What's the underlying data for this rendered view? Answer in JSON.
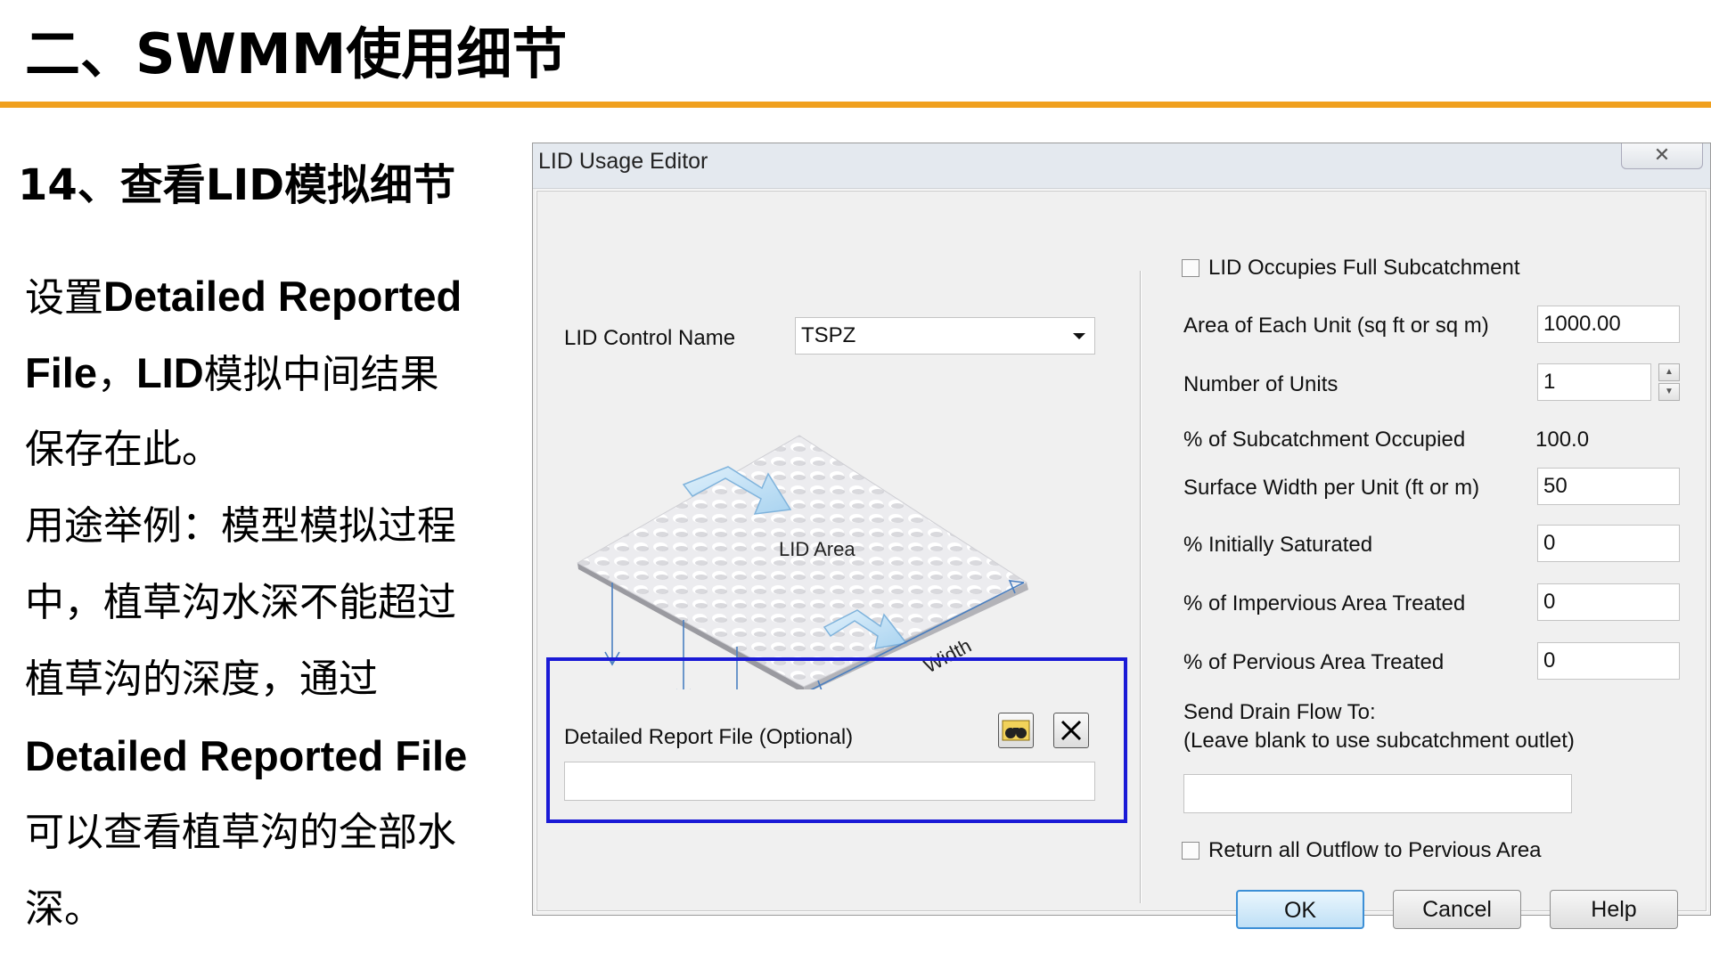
{
  "slide": {
    "title": "二、SWMM使用细节",
    "subtitle": "14、查看LID模拟细节",
    "body": [
      [
        {
          "t": "设置",
          "b": false
        },
        {
          "t": "Detailed Reported",
          "b": true
        }
      ],
      [
        {
          "t": "File",
          "b": true
        },
        {
          "t": "，",
          "b": false
        },
        {
          "t": "LID",
          "b": true
        },
        {
          "t": "模拟中间结果",
          "b": false
        }
      ],
      [
        {
          "t": "保存在此。",
          "b": false
        }
      ],
      [
        {
          "t": "用途举例：模型模拟过程",
          "b": false
        }
      ],
      [
        {
          "t": "中，植草沟水深不能超过",
          "b": false
        }
      ],
      [
        {
          "t": "植草沟的深度，通过",
          "b": false
        }
      ],
      [
        {
          "t": "Detailed Reported File",
          "b": true
        }
      ],
      [
        {
          "t": "可以查看植草沟的全部水",
          "b": false
        }
      ],
      [
        {
          "t": "深。",
          "b": false
        }
      ]
    ],
    "accent_color": "#f0a01e",
    "highlight_color": "#1a1ad6"
  },
  "dialog": {
    "title": "LID Usage Editor",
    "close_glyph": "✕",
    "lid_control_name_label": "LID Control Name",
    "lid_control_name_value": "TSPZ",
    "diagram": {
      "area_label": "LID Area",
      "width_label": "Width"
    },
    "report_file_label": "Detailed Report File (Optional)",
    "report_file_value": "",
    "browse_icon": "binoculars-icon",
    "clear_icon": "close-icon",
    "full_subcatchment_label": "LID Occupies Full Subcatchment",
    "full_subcatchment_checked": false,
    "fields": [
      {
        "key": "area",
        "label": "Area of Each Unit (sq ft or sq m)",
        "value": "1000.00",
        "kind": "input"
      },
      {
        "key": "units",
        "label": "Number of Units",
        "value": "1",
        "kind": "spinner"
      },
      {
        "key": "occupied",
        "label": "% of Subcatchment Occupied",
        "value": "100.0",
        "kind": "readonly"
      },
      {
        "key": "width",
        "label": "Surface Width per Unit (ft or m)",
        "value": "50",
        "kind": "input"
      },
      {
        "key": "saturated",
        "label": "% Initially Saturated",
        "value": "0",
        "kind": "input"
      },
      {
        "key": "impervious",
        "label": "% of Impervious Area Treated",
        "value": "0",
        "kind": "input"
      },
      {
        "key": "pervious",
        "label": " % of Pervious Area Treated",
        "value": "0",
        "kind": "input"
      }
    ],
    "drain_label_1": "Send Drain Flow To:",
    "drain_label_2": "(Leave blank to use subcatchment outlet)",
    "drain_value": "",
    "return_outflow_label": "Return all Outflow to Pervious Area",
    "return_outflow_checked": false,
    "buttons": {
      "ok": "OK",
      "cancel": "Cancel",
      "help": "Help"
    }
  }
}
